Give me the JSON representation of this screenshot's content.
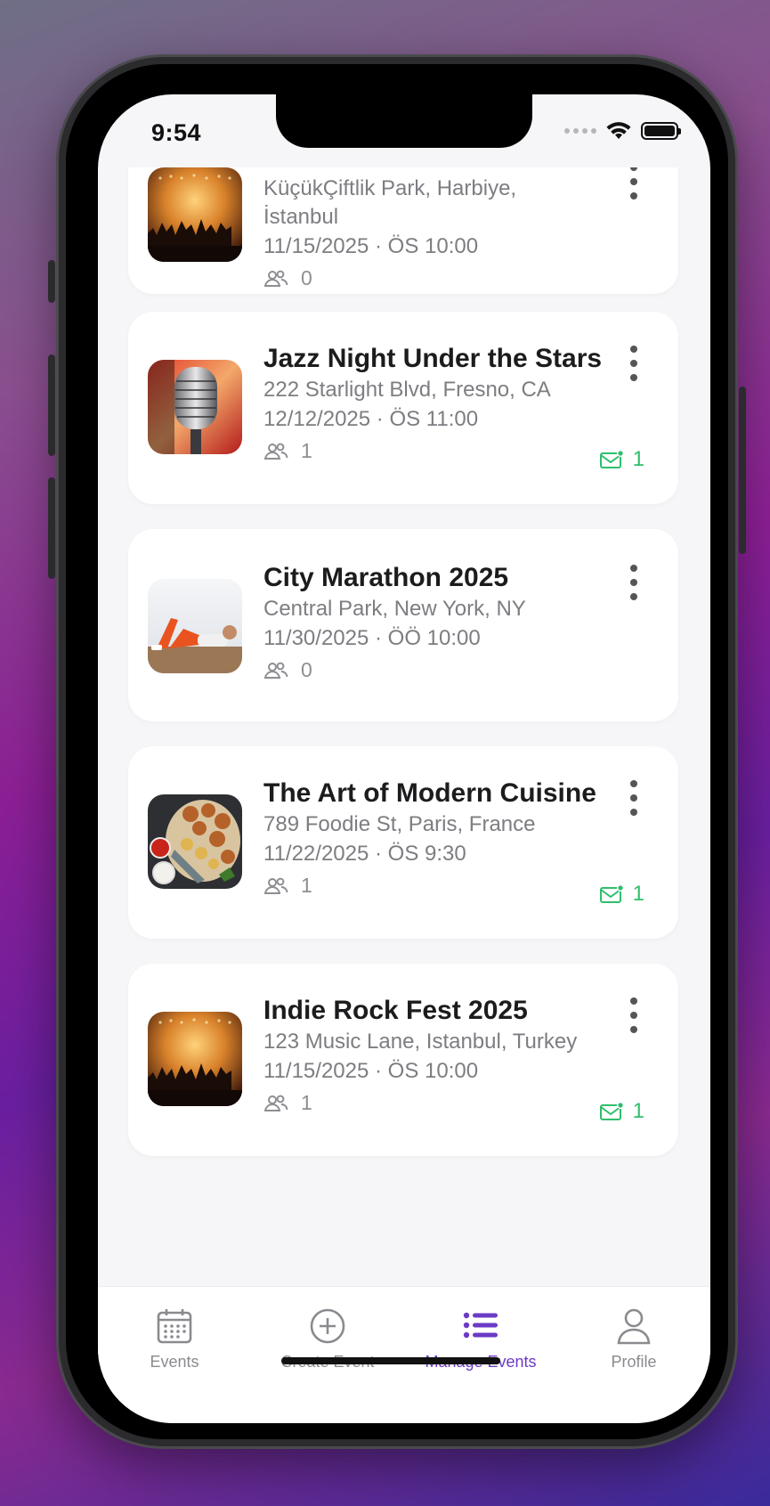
{
  "status_bar": {
    "time": "9:54"
  },
  "events": [
    {
      "title": "",
      "location_line1": "KüçükÇiftlik Park, Harbiye,",
      "location_line2": "İstanbul",
      "datetime": "11/15/2025 · ÖS 10:00",
      "attendees": "0",
      "image": "concert-crowd",
      "invites": null
    },
    {
      "title": "Jazz Night Under the Stars",
      "location_line1": "222 Starlight Blvd, Fresno, CA",
      "datetime": "12/12/2025 · ÖS 11:00",
      "attendees": "1",
      "image": "microphone",
      "invites": "1"
    },
    {
      "title": "City Marathon 2025",
      "location_line1": "Central Park, New York, NY",
      "datetime": "11/30/2025 · ÖÖ 10:00",
      "attendees": "0",
      "image": "runner-stretching",
      "invites": null
    },
    {
      "title": "The Art of Modern Cuisine",
      "location_line1": "789 Foodie St, Paris, France",
      "datetime": "11/22/2025 · ÖS 9:30",
      "attendees": "1",
      "image": "food-platter",
      "invites": "1"
    },
    {
      "title": "Indie Rock Fest 2025",
      "location_line1": "123 Music Lane, Istanbul, Turkey",
      "datetime": "11/15/2025 · ÖS 10:00",
      "attendees": "1",
      "image": "concert-crowd",
      "invites": "1"
    }
  ],
  "tabs": [
    {
      "label": "Events",
      "icon": "calendar-icon",
      "active": false
    },
    {
      "label": "Create Event",
      "icon": "plus-circle-icon",
      "active": false
    },
    {
      "label": "Manage Events",
      "icon": "list-icon",
      "active": true
    },
    {
      "label": "Profile",
      "icon": "person-icon",
      "active": false
    }
  ],
  "colors": {
    "accent": "#6b3bc6",
    "invite_green": "#2fbf6c",
    "text_primary": "#1c1c1e",
    "text_secondary": "#7d7d82"
  }
}
